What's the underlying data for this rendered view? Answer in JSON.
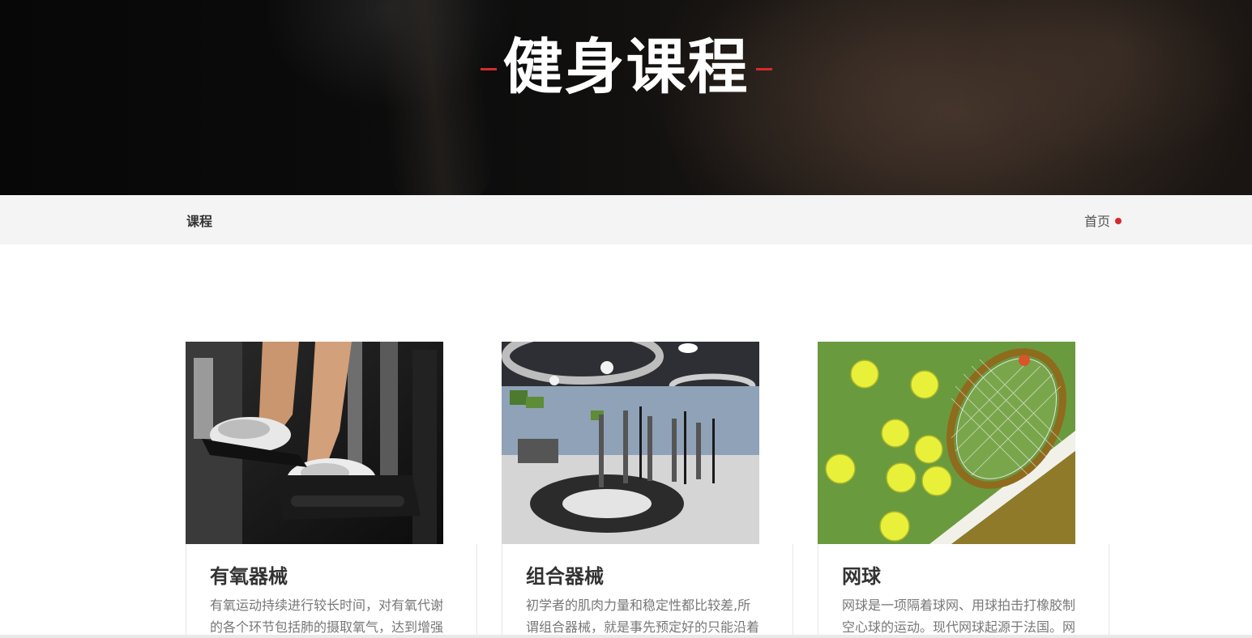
{
  "hero": {
    "title": "健身课程"
  },
  "breadcrumb": {
    "section": "课程",
    "home": "首页"
  },
  "courses": [
    {
      "title": "有氧器械",
      "description": "有氧运动持续进行较长时间，对有氧代谢的各个环节包括肺的摄取氧气，达到增强"
    },
    {
      "title": "组合器械",
      "description": "初学者的肌肉力量和稳定性都比较差,所谓组合器械，就是事先预定好的只能沿着一"
    },
    {
      "title": "网球",
      "description": "网球是一项隔着球网、用球拍击打橡胶制空心球的运动。现代网球起源于法国。网"
    }
  ],
  "colors": {
    "accent": "#d62b2b",
    "crumb_bar": "#f4f4f4",
    "title_text": "#333333",
    "desc_text": "#777777"
  }
}
